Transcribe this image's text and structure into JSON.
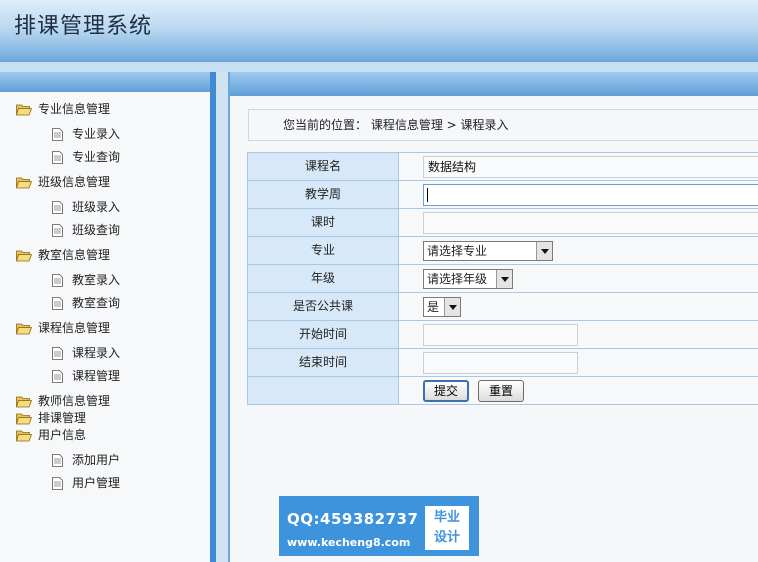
{
  "app": {
    "title": "排课管理系统"
  },
  "colors": {
    "accent": "#3f8ad0",
    "label_bg": "#d7e8f8",
    "header_dark": "#6aa6da"
  },
  "sidebar": {
    "groups": [
      {
        "label": "专业信息管理",
        "icon": "folder-open-icon",
        "items": [
          "专业录入",
          "专业查询"
        ]
      },
      {
        "label": "班级信息管理",
        "icon": "folder-open-icon",
        "items": [
          "班级录入",
          "班级查询"
        ]
      },
      {
        "label": "教室信息管理",
        "icon": "folder-open-icon",
        "items": [
          "教室录入",
          "教室查询"
        ]
      },
      {
        "label": "课程信息管理",
        "icon": "folder-open-icon",
        "items": [
          "课程录入",
          "课程管理"
        ]
      },
      {
        "label": "教师信息管理",
        "icon": "folder-open-icon",
        "items": []
      },
      {
        "label": "排课管理",
        "icon": "folder-open-icon",
        "items": []
      },
      {
        "label": "用户信息",
        "icon": "folder-open-icon",
        "items": [
          "添加用户",
          "用户管理"
        ]
      }
    ]
  },
  "breadcrumb": {
    "prefix": "您当前的位置：",
    "path": "课程信息管理 > 课程录入"
  },
  "form": {
    "fields": [
      {
        "label": "课程名",
        "value": "数据结构",
        "type": "text"
      },
      {
        "label": "教学周",
        "value": "",
        "type": "text"
      },
      {
        "label": "课时",
        "value": "",
        "type": "text"
      },
      {
        "label": "专业",
        "value": "请选择专业",
        "type": "select"
      },
      {
        "label": "年级",
        "value": "请选择年级",
        "type": "select"
      },
      {
        "label": "是否公共课",
        "value": "是",
        "type": "select"
      },
      {
        "label": "开始时间",
        "value": "",
        "type": "text"
      },
      {
        "label": "结束时间",
        "value": "",
        "type": "text"
      }
    ],
    "submit_label": "提交",
    "reset_label": "重置"
  },
  "watermark": {
    "qq": "QQ:459382737",
    "url": "www.kecheng8.com",
    "badge_line1": "毕业",
    "badge_line2": "设计"
  }
}
